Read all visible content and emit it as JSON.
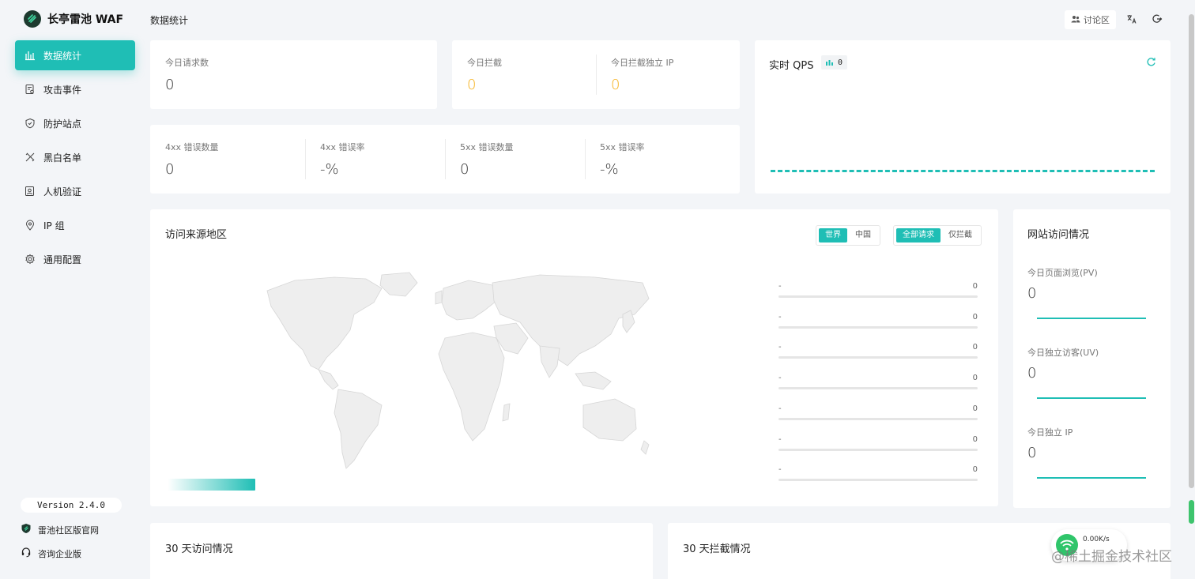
{
  "brand": {
    "name": "长亭雷池 WAF"
  },
  "sidebar": {
    "items": [
      {
        "label": "数据统计",
        "icon": "bar-chart-icon",
        "active": true
      },
      {
        "label": "攻击事件",
        "icon": "document-search-icon",
        "active": false
      },
      {
        "label": "防护站点",
        "icon": "shield-icon",
        "active": false
      },
      {
        "label": "黑白名单",
        "icon": "tools-icon",
        "active": false
      },
      {
        "label": "人机验证",
        "icon": "person-verify-icon",
        "active": false
      },
      {
        "label": "IP 组",
        "icon": "location-pin-icon",
        "active": false
      },
      {
        "label": "通用配置",
        "icon": "gear-icon",
        "active": false
      }
    ],
    "version": "Version 2.4.0",
    "community_link": "雷池社区版官网",
    "enterprise_link": "咨询企业版"
  },
  "header": {
    "page_title": "数据统计",
    "forum_label": "讨论区"
  },
  "stats": {
    "today_requests": {
      "label": "今日请求数",
      "value": "0"
    },
    "today_blocked": {
      "label": "今日拦截",
      "value": "0"
    },
    "today_blocked_ip": {
      "label": "今日拦截独立 IP",
      "value": "0"
    },
    "err4xx_count": {
      "label": "4xx 错误数量",
      "value": "0"
    },
    "err4xx_rate": {
      "label": "4xx 错误率",
      "value": "-%"
    },
    "err5xx_count": {
      "label": "5xx 错误数量",
      "value": "0"
    },
    "err5xx_rate": {
      "label": "5xx 错误率",
      "value": "-%"
    }
  },
  "qps": {
    "title": "实时 QPS",
    "value": "0"
  },
  "map_card": {
    "title": "访问来源地区",
    "scope_options": [
      "世界",
      "中国"
    ],
    "scope_selected": "世界",
    "filter_options": [
      "全部请求",
      "仅拦截"
    ],
    "filter_selected": "全部请求",
    "ranking": [
      {
        "name": "-",
        "value": "0"
      },
      {
        "name": "-",
        "value": "0"
      },
      {
        "name": "-",
        "value": "0"
      },
      {
        "name": "-",
        "value": "0"
      },
      {
        "name": "-",
        "value": "0"
      },
      {
        "name": "-",
        "value": "0"
      },
      {
        "name": "-",
        "value": "0"
      }
    ]
  },
  "site_visits": {
    "title": "网站访问情况",
    "pv": {
      "label": "今日页面浏览(PV)",
      "value": "0"
    },
    "uv": {
      "label": "今日独立访客(UV)",
      "value": "0"
    },
    "ip": {
      "label": "今日独立 IP",
      "value": "0"
    }
  },
  "visits_30d": {
    "title": "30 天访问情况"
  },
  "blocked_30d": {
    "title": "30 天拦截情况"
  },
  "speed_widget": {
    "value": "0.00K/s"
  },
  "watermark": "@稀土掘金技术社区",
  "colors": {
    "accent": "#1fbeb5",
    "orange": "#f6b21f"
  }
}
